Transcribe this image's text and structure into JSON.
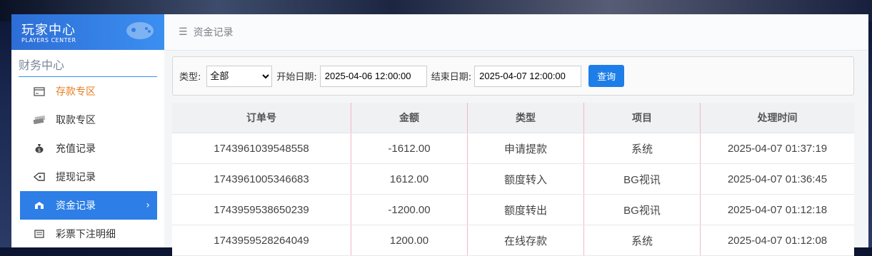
{
  "logo": {
    "title": "玩家中心",
    "subtitle": "PLAYERS CENTER"
  },
  "sidebar": {
    "section_title": "财务中心",
    "items": [
      {
        "label": "存款专区",
        "icon": "card-icon"
      },
      {
        "label": "取款专区",
        "icon": "cash-icon"
      },
      {
        "label": "充值记录",
        "icon": "money-bag-icon"
      },
      {
        "label": "提现记录",
        "icon": "withdraw-icon"
      },
      {
        "label": "资金记录",
        "icon": "funds-icon"
      },
      {
        "label": "彩票下注明细",
        "icon": "list-icon"
      }
    ],
    "highlight_color": "#e67e22",
    "active_color": "#2d7ee6"
  },
  "breadcrumb": {
    "icon": "☰",
    "text": "资金记录"
  },
  "filter": {
    "type_label": "类型:",
    "type_selected": "全部",
    "start_label": "开始日期:",
    "start_value": "2025-04-06 12:00:00",
    "end_label": "结束日期:",
    "end_value": "2025-04-07 12:00:00",
    "query_button": "查询"
  },
  "table": {
    "headers": [
      "订单号",
      "金额",
      "类型",
      "项目",
      "处理时间"
    ],
    "rows": [
      [
        "1743961039548558",
        "-1612.00",
        "申请提款",
        "系统",
        "2025-04-07 01:37:19"
      ],
      [
        "1743961005346683",
        "1612.00",
        "额度转入",
        "BG视讯",
        "2025-04-07 01:36:45"
      ],
      [
        "1743959538650239",
        "-1200.00",
        "额度转出",
        "BG视讯",
        "2025-04-07 01:12:18"
      ],
      [
        "1743959528264049",
        "1200.00",
        "在线存款",
        "系统",
        "2025-04-07 01:12:08"
      ]
    ]
  }
}
